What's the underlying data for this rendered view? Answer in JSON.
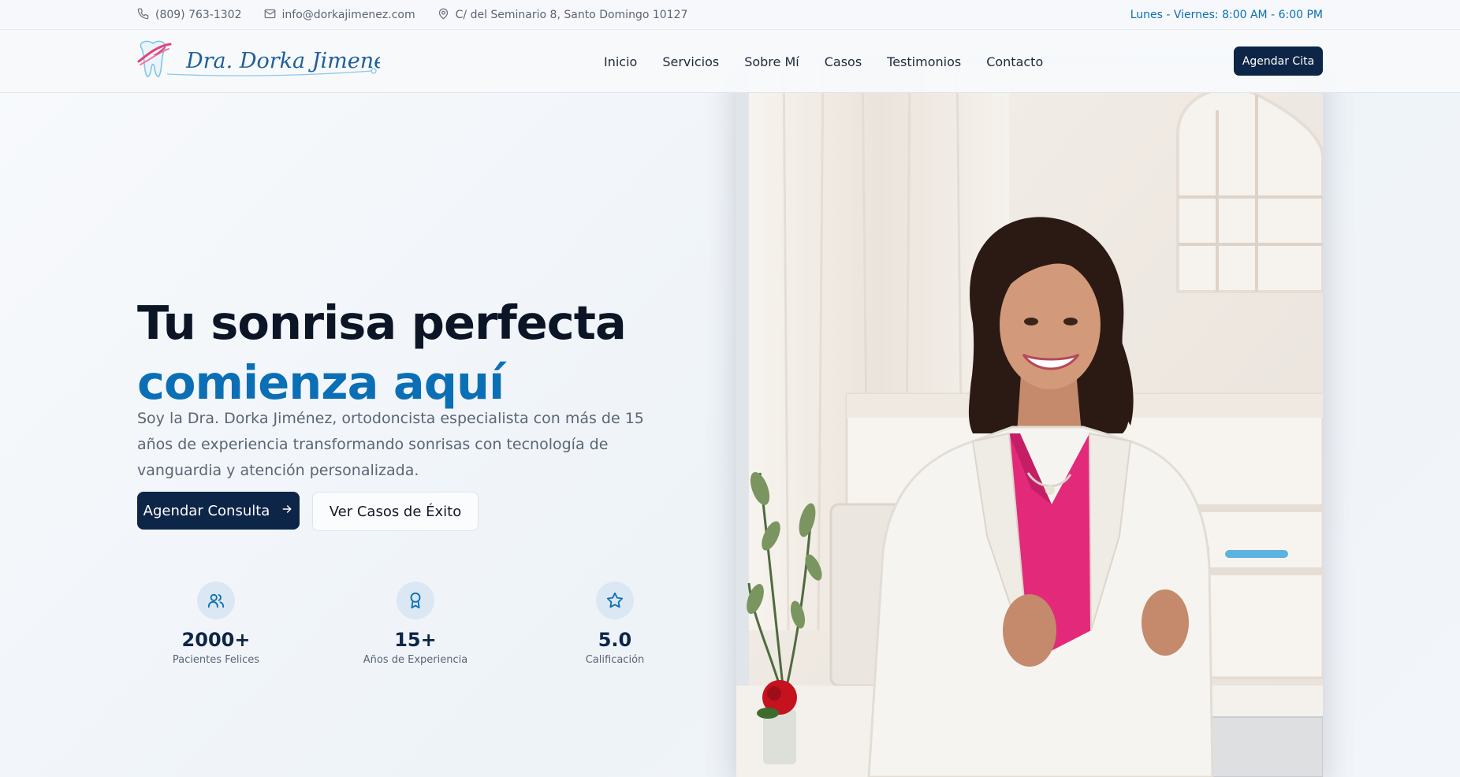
{
  "topbar": {
    "phone": "(809) 763-1302",
    "email": "info@dorkajimenez.com",
    "address": "C/ del Seminario 8, Santo Domingo 10127",
    "hours": "Lunes - Viernes: 8:00 AM - 6:00 PM"
  },
  "header": {
    "logo_text": "Dra. Dorka Jimenez",
    "nav": [
      "Inicio",
      "Servicios",
      "Sobre Mí",
      "Casos",
      "Testimonios",
      "Contacto"
    ],
    "cta": "Agendar Cita"
  },
  "hero": {
    "title_line1": "Tu sonrisa perfecta",
    "title_line2": "comienza aquí",
    "description": "Soy la Dra. Dorka Jiménez, ortodoncista especialista con más de 15 años de experiencia transformando sonrisas con tecnología de vanguardia y atención personalizada.",
    "primary_button": "Agendar Consulta",
    "secondary_button": "Ver Casos de Éxito"
  },
  "stats": [
    {
      "icon": "users-icon",
      "value": "2000+",
      "label": "Pacientes Felices"
    },
    {
      "icon": "award-icon",
      "value": "15+",
      "label": "Años de Experiencia"
    },
    {
      "icon": "star-icon",
      "value": "5.0",
      "label": "Calificación"
    }
  ],
  "colors": {
    "navy": "#0d2547",
    "accent_blue": "#0b6fb5",
    "logo_pink": "#e2447b"
  }
}
